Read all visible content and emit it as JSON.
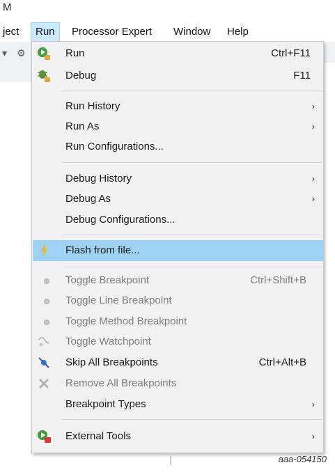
{
  "window": {
    "title_fragment": "M"
  },
  "menubar": [
    "ject",
    "Run",
    "Processor Expert",
    "Window",
    "Help"
  ],
  "menu": {
    "run": {
      "label": "Run",
      "shortcut": "Ctrl+F11"
    },
    "debug": {
      "label": "Debug",
      "shortcut": "F11"
    },
    "run_history": {
      "label": "Run History",
      "arrow": "›"
    },
    "run_as": {
      "label": "Run As",
      "arrow": "›"
    },
    "run_configurations": {
      "label": "Run Configurations..."
    },
    "debug_history": {
      "label": "Debug History",
      "arrow": "›"
    },
    "debug_as": {
      "label": "Debug As",
      "arrow": "›"
    },
    "debug_configurations": {
      "label": "Debug Configurations..."
    },
    "flash_from_file": {
      "label": "Flash from file..."
    },
    "toggle_breakpoint": {
      "label": "Toggle Breakpoint",
      "shortcut": "Ctrl+Shift+B"
    },
    "toggle_line_breakpoint": {
      "label": "Toggle Line Breakpoint"
    },
    "toggle_method_breakpoint": {
      "label": "Toggle Method Breakpoint"
    },
    "toggle_watchpoint": {
      "label": "Toggle Watchpoint"
    },
    "skip_all_breakpoints": {
      "label": "Skip All Breakpoints",
      "shortcut": "Ctrl+Alt+B"
    },
    "remove_all_breakpoints": {
      "label": "Remove All Breakpoints"
    },
    "breakpoint_types": {
      "label": "Breakpoint Types",
      "arrow": "›"
    },
    "external_tools": {
      "label": "External Tools",
      "arrow": "›"
    }
  },
  "caption": "aaa-054150",
  "colors": {
    "highlight": "#9fd3f6",
    "menu_bg": "#f2f2f2",
    "menubar_active": "#cce8ff",
    "disabled_text": "#7d7d7d"
  }
}
